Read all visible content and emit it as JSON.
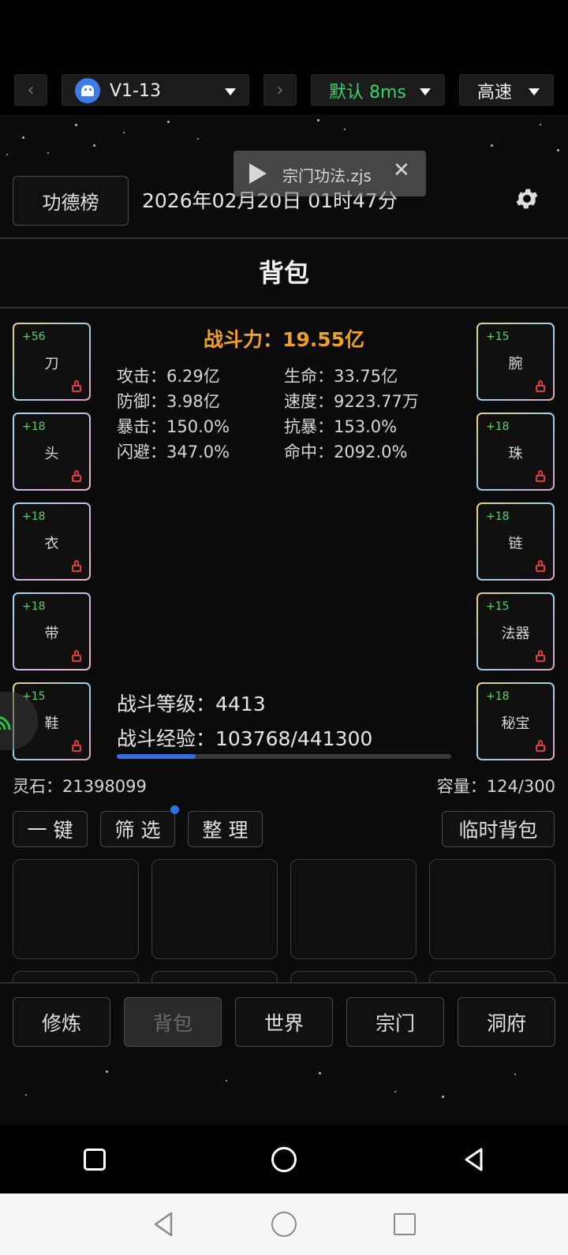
{
  "emulator_bar": {
    "back_arrow": "‹",
    "forward_arrow": "›",
    "device": "V1-13",
    "route": "默认 8ms",
    "speed": "高速"
  },
  "script_toast": {
    "filename": "宗门功法.zjs",
    "close": "✕"
  },
  "header": {
    "ranking_button": "功德榜",
    "datetime": "2026年02月20日 01时47分"
  },
  "page_title": "背包",
  "combat": {
    "power": "战斗力：19.55亿",
    "stats_left": [
      "攻击：6.29亿",
      "防御：3.98亿",
      "暴击：150.0%",
      "闪避：347.0%"
    ],
    "stats_right": [
      "生命：33.75亿",
      "速度：9223.77万",
      "抗暴：153.0%",
      "命中：2092.0%"
    ],
    "level": "战斗等级：4413",
    "exp": "战斗经验：103768/441300",
    "exp_progress": 0.235
  },
  "equipment_left": [
    {
      "level": "+56",
      "name": "刀"
    },
    {
      "level": "+18",
      "name": "头"
    },
    {
      "level": "+18",
      "name": "衣"
    },
    {
      "level": "+18",
      "name": "带"
    },
    {
      "level": "+15",
      "name": "鞋"
    }
  ],
  "equipment_right": [
    {
      "level": "+15",
      "name": "腕"
    },
    {
      "level": "+18",
      "name": "珠"
    },
    {
      "level": "+18",
      "name": "链"
    },
    {
      "level": "+15",
      "name": "法器"
    },
    {
      "level": "+18",
      "name": "秘宝"
    }
  ],
  "resources": {
    "spirit_stones": "灵石：21398099",
    "capacity": "容量：124/300"
  },
  "actions": {
    "one_key": "一 键",
    "filter": "筛 选",
    "sort": "整 理",
    "temp_bag": "临时背包"
  },
  "bottom_tabs": [
    "修炼",
    "背包",
    "世界",
    "宗门",
    "洞府"
  ],
  "colors": {
    "power": "#f0a020",
    "level_green": "#5fd06b",
    "lock_red": "#e23b3b",
    "progress_blue": "#2f6fe0",
    "route_green": "#36d66a"
  }
}
